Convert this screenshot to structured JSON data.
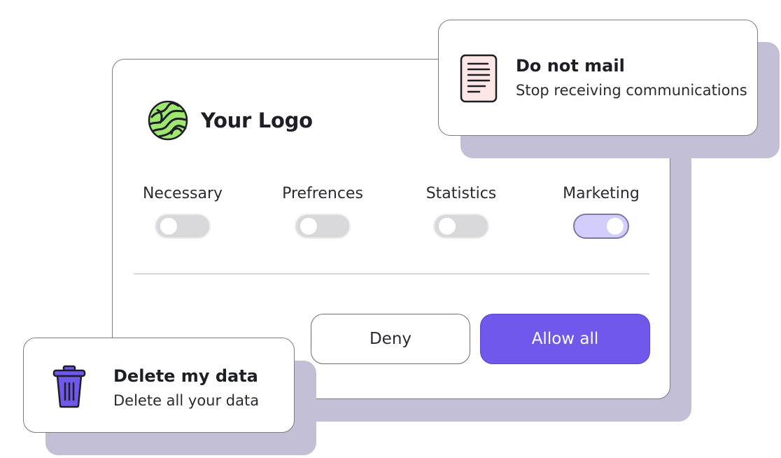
{
  "brand": {
    "logo_text": "Your Logo",
    "logo_icon": "swirl-globe-icon",
    "logo_color": "#9fe870"
  },
  "consent": {
    "toggles": [
      {
        "label": "Necessary",
        "enabled": false
      },
      {
        "label": "Prefrences",
        "enabled": false
      },
      {
        "label": "Statistics",
        "enabled": false
      },
      {
        "label": "Marketing",
        "enabled": true
      }
    ],
    "deny_label": "Deny",
    "allow_label": "Allow all",
    "accent_color": "#6f58eb"
  },
  "do_not_mail": {
    "icon": "document-icon",
    "title": "Do not mail",
    "subtitle": "Stop receiving communications"
  },
  "delete_data": {
    "icon": "trash-icon",
    "title": "Delete my data",
    "subtitle": "Delete all your data",
    "icon_color": "#6f58eb"
  }
}
